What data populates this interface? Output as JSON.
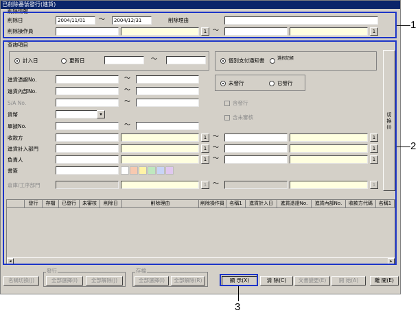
{
  "window": {
    "title": "已削除番號發行(進貨)"
  },
  "delete_info": {
    "group_label": "削除情報",
    "date_label": "削除日",
    "date_from": "2004/11/01",
    "date_to": "2004/12/31",
    "reason_label": "削除理由",
    "operator_label": "削除操作員",
    "tilde": "～",
    "search_btn": "1"
  },
  "query": {
    "group_label": "查詢項目",
    "radio_input_date": "計入日",
    "radio_update_date": "更新日",
    "radio_individual": "個別支付通知書",
    "radio_other": "選択記帳",
    "radio_unissued": "未發行",
    "radio_issued": "已發行",
    "check_include_issued": "含發行",
    "check_include_unreviewed": "含未審核",
    "switch_label": "切換(I)",
    "fields": [
      {
        "label": "進貨憑證No."
      },
      {
        "label": "進貨內部No."
      },
      {
        "label": "S/A No."
      },
      {
        "label": "貨幣"
      },
      {
        "label": "單據No."
      },
      {
        "label": "收款方"
      },
      {
        "label": "進貨計入部門"
      },
      {
        "label": "負責人"
      },
      {
        "label": "書簽"
      },
      {
        "label": "倉庫/工序部門"
      }
    ]
  },
  "grid": {
    "columns": [
      "",
      "發行",
      "存檔",
      "已發行",
      "未審核",
      "削除日",
      "削除理由",
      "削除操作員",
      "名稱1",
      "進貨計入日",
      "進貨憑證No.",
      "進貨內部No.",
      "收款方代碼",
      "名稱1"
    ]
  },
  "footer": {
    "issue_group": "發行",
    "archive_group": "存檔",
    "name_switch": "名稱切換(J)",
    "select_all_1": "全部選擇(I)",
    "clear_all_1": "全部解除(J)",
    "select_all_2": "全部選擇(I)",
    "clear_all_2": "全部解除(R)",
    "display": "顯  示(X)",
    "clear": "清  除(C)",
    "doc_change": "文書變更(E)",
    "print": "開  始(A)",
    "close": "離  開(E)"
  },
  "callouts": {
    "one": "1",
    "two": "2",
    "three": "3"
  }
}
